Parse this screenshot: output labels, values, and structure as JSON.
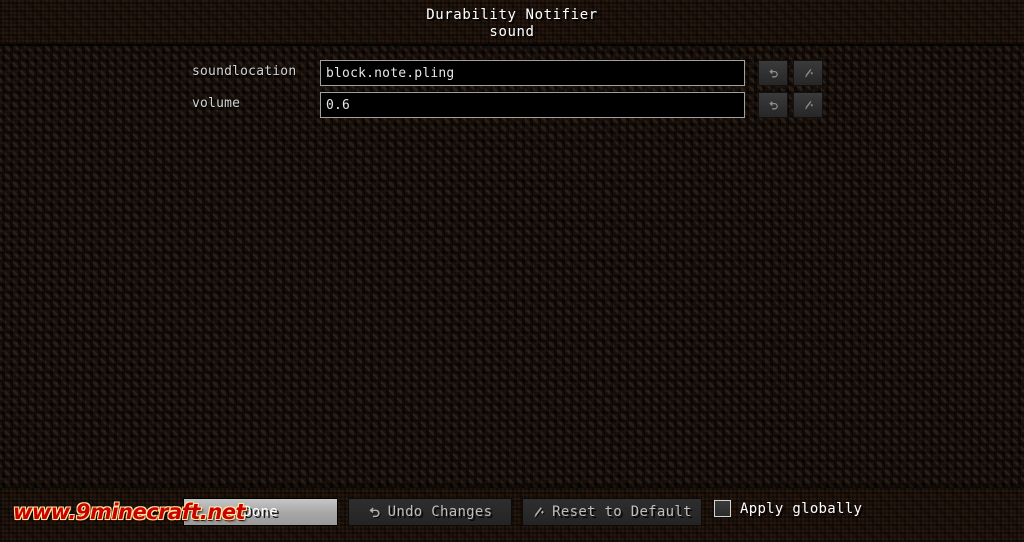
{
  "header": {
    "title": "Durability Notifier",
    "subtitle": "sound"
  },
  "rows": [
    {
      "label": "soundlocation",
      "value": "block.note.pling",
      "undo_icon": "undo-arrow-icon",
      "reset_icon": "magic-wand-icon"
    },
    {
      "label": "volume",
      "value": "0.6",
      "undo_icon": "undo-arrow-icon",
      "reset_icon": "magic-wand-icon"
    }
  ],
  "bottom_bar": {
    "done_label": "Done",
    "undo_label": "Undo Changes",
    "undo_icon": "undo-arrow-icon",
    "reset_label": "Reset to Default",
    "reset_icon": "magic-wand-icon",
    "apply_globally_label": "Apply globally",
    "apply_globally_checked": false
  },
  "watermark": {
    "text": "www.9minecraft.net"
  },
  "colors": {
    "dirt_band": "#3b281b",
    "body_background": "#130c08",
    "field_border": "#a0a0a0",
    "field_background": "#000000",
    "text_primary": "#ffffff",
    "text_label": "#d2d2d2",
    "done_button": "#a8a8a8",
    "dark_button": "#2b2b2b",
    "watermark": "#cc0000"
  }
}
